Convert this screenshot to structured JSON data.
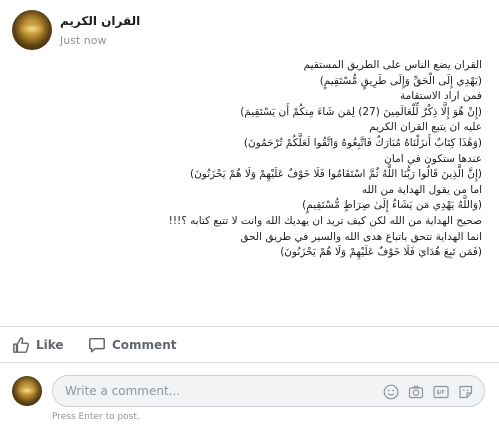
{
  "post": {
    "author": "القران الكريم",
    "time": "Just now",
    "lines": [
      "القران يضع الناس على الطريق المستقيم",
      "(يَهْدِي إِلَى الْحَقِّ وَإِلَى طَرِيقٍ مُّسْتَقِيمٍ)",
      "فمن اراد الاستقامة",
      "(إِنْ هُوَ إِلَّا ذِكْرٌ لِّلْعَالَمِينَ (27) لِمَن شَاءَ مِنكُمْ أَن يَسْتَقِيمَ)",
      "عليه ان يتبع القران الكريم",
      "(وَهَٰذَا كِتَابٌ أَنزَلْنَاهُ مُبَارَكٌ فَاتَّبِعُوهُ وَاتَّقُوا لَعَلَّكُمْ تُرْحَمُونَ)",
      "عندها ستكون في امان",
      "(إِنَّ الَّذِينَ قَالُوا رَبُّنَا اللَّهُ ثُمَّ اسْتَقَامُوا فَلَا خَوْفٌ عَلَيْهِمْ وَلَا هُمْ يَحْزَنُونَ)",
      "اما من يقول الهداية من الله",
      "(وَاللَّهُ يَهْدِي مَن يَشَاءُ إِلَىٰ صِرَاطٍ مُّسْتَقِيمٍ)",
      "صحيح الهداية من الله لكن كيف تريد ان يهديك الله وانت لا تتبع كتابه ؟!!!",
      "انما الهداية تتحق باتباع هدى الله والسير في طريق الحق",
      "(فَمَن تَبِعَ هُدَايَ فَلَا خَوْفٌ عَلَيْهِمْ وَلَا هُمْ يَحْزَنُونَ)"
    ]
  },
  "actions": {
    "like_label": "Like",
    "comment_label": "Comment"
  },
  "composer": {
    "placeholder": "Write a comment...",
    "hint": "Press Enter to post."
  },
  "colors": {
    "secondary_text": "#606770",
    "muted": "#8d949e",
    "divider": "#dadde1",
    "input_bg": "#f2f3f5"
  },
  "icons": [
    "like-icon",
    "comment-icon",
    "emoji-icon",
    "camera-icon",
    "gif-icon",
    "sticker-icon"
  ]
}
